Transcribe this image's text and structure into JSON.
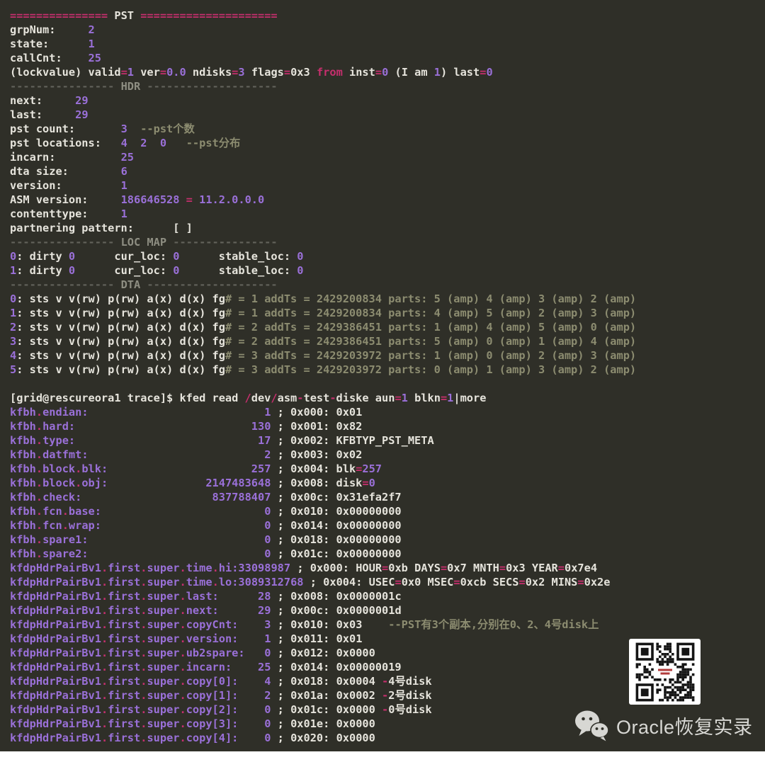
{
  "colors": {
    "bg": "#2f2f28",
    "w": "#e6e4dc",
    "pk": "#c62f6d",
    "pu": "#9a70d8",
    "nm": "#9a70d8",
    "ol": "#8c8c70",
    "gr": "#62625a",
    "grl": "#8e8e82",
    "qr_dark": "#151515",
    "qr_red": "#b23b3b"
  },
  "icons": {
    "wechat": "wechat-chat-bubbles-icon",
    "qr": "qr-code"
  },
  "footer": {
    "brand": "Oracle恢复实录"
  },
  "terminal": {
    "value_col": 40,
    "lines": [
      {
        "n": "pst-header",
        "seg": [
          [
            "pk",
            "==============="
          ],
          [
            "w",
            " PST "
          ],
          [
            "pk",
            "====================="
          ]
        ]
      },
      {
        "n": "grpnum",
        "seg": [
          [
            "w",
            "grpNum:     "
          ],
          [
            "pu",
            "2"
          ]
        ]
      },
      {
        "n": "state",
        "seg": [
          [
            "w",
            "state:      "
          ],
          [
            "pu",
            "1"
          ]
        ]
      },
      {
        "n": "callcnt",
        "seg": [
          [
            "w",
            "callCnt:    "
          ],
          [
            "pu",
            "25"
          ]
        ]
      },
      {
        "n": "lockvalue",
        "seg": [
          [
            "w",
            "(lockvalue) valid"
          ],
          [
            "pk",
            "="
          ],
          [
            "pu",
            "1"
          ],
          [
            "w",
            " ver"
          ],
          [
            "pk",
            "="
          ],
          [
            "pu",
            "0.0"
          ],
          [
            "w",
            " ndisks"
          ],
          [
            "pk",
            "="
          ],
          [
            "pu",
            "3"
          ],
          [
            "w",
            " flags"
          ],
          [
            "pk",
            "="
          ],
          [
            "w",
            "0x3 "
          ],
          [
            "pk",
            "from"
          ],
          [
            "w",
            " inst"
          ],
          [
            "pk",
            "="
          ],
          [
            "pu",
            "0"
          ],
          [
            "w",
            " (I am "
          ],
          [
            "pu",
            "1"
          ],
          [
            "w",
            ") last"
          ],
          [
            "pk",
            "="
          ],
          [
            "pu",
            "0"
          ]
        ]
      },
      {
        "n": "hdr-divider",
        "seg": [
          [
            "gr",
            "----------------"
          ],
          [
            "grl",
            " HDR "
          ],
          [
            "gr",
            "--------------------"
          ]
        ]
      },
      {
        "n": "next",
        "seg": [
          [
            "w",
            "next:     "
          ],
          [
            "pu",
            "29"
          ]
        ]
      },
      {
        "n": "last",
        "seg": [
          [
            "w",
            "last:     "
          ],
          [
            "pu",
            "29"
          ]
        ]
      },
      {
        "n": "pst-count",
        "seg": [
          [
            "w",
            "pst count:       "
          ],
          [
            "pu",
            "3"
          ],
          [
            "ol",
            "  --pst个数"
          ]
        ]
      },
      {
        "n": "pst-locations",
        "seg": [
          [
            "w",
            "pst locations:   "
          ],
          [
            "pu",
            "4"
          ],
          [
            "w",
            "  "
          ],
          [
            "pu",
            "2"
          ],
          [
            "w",
            "  "
          ],
          [
            "pu",
            "0"
          ],
          [
            "ol",
            "   --pst分布"
          ]
        ]
      },
      {
        "n": "incarn",
        "seg": [
          [
            "w",
            "incarn:          "
          ],
          [
            "pu",
            "25"
          ]
        ]
      },
      {
        "n": "dta-size",
        "seg": [
          [
            "w",
            "dta size:        "
          ],
          [
            "pu",
            "6"
          ]
        ]
      },
      {
        "n": "version",
        "seg": [
          [
            "w",
            "version:         "
          ],
          [
            "pu",
            "1"
          ]
        ]
      },
      {
        "n": "asm-version",
        "seg": [
          [
            "w",
            "ASM version:     "
          ],
          [
            "pu",
            "186646528"
          ],
          [
            "w",
            " "
          ],
          [
            "pk",
            "="
          ],
          [
            "w",
            " "
          ],
          [
            "pu",
            "11.2.0.0.0"
          ]
        ]
      },
      {
        "n": "contenttype",
        "seg": [
          [
            "w",
            "contenttype:     "
          ],
          [
            "pu",
            "1"
          ]
        ]
      },
      {
        "n": "partnering-pattern",
        "seg": [
          [
            "w",
            "partnering pattern:      [ ]"
          ]
        ]
      },
      {
        "n": "locmap-divider",
        "seg": [
          [
            "gr",
            "----------------"
          ],
          [
            "grl",
            " LOC MAP "
          ],
          [
            "gr",
            "----------------"
          ]
        ]
      },
      {
        "n": "locmap-0",
        "seg": [
          [
            "pu",
            "0"
          ],
          [
            "w",
            ": dirty "
          ],
          [
            "pu",
            "0"
          ],
          [
            "w",
            "      cur_loc: "
          ],
          [
            "pu",
            "0"
          ],
          [
            "w",
            "      stable_loc: "
          ],
          [
            "pu",
            "0"
          ]
        ]
      },
      {
        "n": "locmap-1",
        "seg": [
          [
            "pu",
            "1"
          ],
          [
            "w",
            ": dirty "
          ],
          [
            "pu",
            "0"
          ],
          [
            "w",
            "      cur_loc: "
          ],
          [
            "pu",
            "0"
          ],
          [
            "w",
            "      stable_loc: "
          ],
          [
            "pu",
            "0"
          ]
        ]
      },
      {
        "n": "dta-divider",
        "seg": [
          [
            "gr",
            "----------------"
          ],
          [
            "grl",
            " DTA "
          ],
          [
            "gr",
            "--------------------"
          ]
        ]
      },
      {
        "n": "dta-0",
        "seg": [
          [
            "pu",
            "0"
          ],
          [
            "w",
            ": sts v v(rw) p(rw) a(x) d(x) fg"
          ],
          [
            "ol",
            "# = 1 addTs = 2429200834 parts: 5 (amp) 4 (amp) 3 (amp) 2 (amp)"
          ]
        ]
      },
      {
        "n": "dta-1",
        "seg": [
          [
            "pu",
            "1"
          ],
          [
            "w",
            ": sts v v(rw) p(rw) a(x) d(x) fg"
          ],
          [
            "ol",
            "# = 1 addTs = 2429200834 parts: 4 (amp) 5 (amp) 2 (amp) 3 (amp)"
          ]
        ]
      },
      {
        "n": "dta-2",
        "seg": [
          [
            "pu",
            "2"
          ],
          [
            "w",
            ": sts v v(rw) p(rw) a(x) d(x) fg"
          ],
          [
            "ol",
            "# = 2 addTs = 2429386451 parts: 1 (amp) 4 (amp) 5 (amp) 0 (amp)"
          ]
        ]
      },
      {
        "n": "dta-3",
        "seg": [
          [
            "pu",
            "3"
          ],
          [
            "w",
            ": sts v v(rw) p(rw) a(x) d(x) fg"
          ],
          [
            "ol",
            "# = 2 addTs = 2429386451 parts: 5 (amp) 0 (amp) 1 (amp) 4 (amp)"
          ]
        ]
      },
      {
        "n": "dta-4",
        "seg": [
          [
            "pu",
            "4"
          ],
          [
            "w",
            ": sts v v(rw) p(rw) a(x) d(x) fg"
          ],
          [
            "ol",
            "# = 3 addTs = 2429203972 parts: 1 (amp) 0 (amp) 2 (amp) 3 (amp)"
          ]
        ]
      },
      {
        "n": "dta-5",
        "seg": [
          [
            "pu",
            "5"
          ],
          [
            "w",
            ": sts v v(rw) p(rw) a(x) d(x) fg"
          ],
          [
            "ol",
            "# = 3 addTs = 2429203972 parts: 0 (amp) 1 (amp) 3 (amp) 2 (amp)"
          ]
        ]
      },
      {
        "n": "blank",
        "seg": []
      },
      {
        "n": "command-prompt",
        "seg": [
          [
            "w",
            "[grid@rescureora1 trace]$ kfed read "
          ],
          [
            "pk",
            "/"
          ],
          [
            "w",
            "dev"
          ],
          [
            "pk",
            "/"
          ],
          [
            "w",
            "asm"
          ],
          [
            "pk",
            "-"
          ],
          [
            "w",
            "test"
          ],
          [
            "pk",
            "-"
          ],
          [
            "w",
            "diske aun"
          ],
          [
            "pk",
            "="
          ],
          [
            "pu",
            "1"
          ],
          [
            "w",
            " blkn"
          ],
          [
            "pk",
            "="
          ],
          [
            "pu",
            "1"
          ],
          [
            "w",
            "|more"
          ]
        ]
      },
      {
        "n": "kfbh-endian",
        "row": {
          "name": "kfbh.endian:",
          "value": "1",
          "suffix": [
            [
              "w",
              " ; 0x000: 0x01"
            ]
          ]
        }
      },
      {
        "n": "kfbh-hard",
        "row": {
          "name": "kfbh.hard:",
          "value": "130",
          "suffix": [
            [
              "w",
              " ; 0x001: 0x82"
            ]
          ]
        }
      },
      {
        "n": "kfbh-type",
        "row": {
          "name": "kfbh.type:",
          "value": "17",
          "suffix": [
            [
              "w",
              " ; 0x002: KFBTYP_PST_META"
            ]
          ]
        }
      },
      {
        "n": "kfbh-datfmt",
        "row": {
          "name": "kfbh.datfmt:",
          "value": "2",
          "suffix": [
            [
              "w",
              " ; 0x003: 0x02"
            ]
          ]
        }
      },
      {
        "n": "kfbh-block-blk",
        "row": {
          "name": "kfbh.block.blk:",
          "value": "257",
          "suffix": [
            [
              "w",
              " ; 0x004: blk"
            ],
            [
              "pk",
              "="
            ],
            [
              "pu",
              "257"
            ]
          ]
        }
      },
      {
        "n": "kfbh-block-obj",
        "row": {
          "name": "kfbh.block.obj:",
          "value": "2147483648",
          "suffix": [
            [
              "w",
              " ; 0x008: disk"
            ],
            [
              "pk",
              "="
            ],
            [
              "pu",
              "0"
            ]
          ]
        }
      },
      {
        "n": "kfbh-check",
        "row": {
          "name": "kfbh.check:",
          "value": "837788407",
          "suffix": [
            [
              "w",
              " ; 0x00c: 0x31efa2f7"
            ]
          ]
        }
      },
      {
        "n": "kfbh-fcn-base",
        "row": {
          "name": "kfbh.fcn.base:",
          "value": "0",
          "suffix": [
            [
              "w",
              " ; 0x010: 0x00000000"
            ]
          ]
        }
      },
      {
        "n": "kfbh-fcn-wrap",
        "row": {
          "name": "kfbh.fcn.wrap:",
          "value": "0",
          "suffix": [
            [
              "w",
              " ; 0x014: 0x00000000"
            ]
          ]
        }
      },
      {
        "n": "kfbh-spare1",
        "row": {
          "name": "kfbh.spare1:",
          "value": "0",
          "suffix": [
            [
              "w",
              " ; 0x018: 0x00000000"
            ]
          ]
        }
      },
      {
        "n": "kfbh-spare2",
        "row": {
          "name": "kfbh.spare2:",
          "value": "0",
          "suffix": [
            [
              "w",
              " ; 0x01c: 0x00000000"
            ]
          ]
        }
      },
      {
        "n": "kfdp-time-hi",
        "row": {
          "name": "kfdpHdrPairBv1.first.super.time.hi:",
          "value": "33098987",
          "suffix": [
            [
              "w",
              " ; 0x000: HOUR"
            ],
            [
              "pk",
              "="
            ],
            [
              "w",
              "0xb DAYS"
            ],
            [
              "pk",
              "="
            ],
            [
              "w",
              "0x7 MNTH"
            ],
            [
              "pk",
              "="
            ],
            [
              "w",
              "0x3 YEAR"
            ],
            [
              "pk",
              "="
            ],
            [
              "w",
              "0x7e4"
            ]
          ]
        }
      },
      {
        "n": "kfdp-time-lo",
        "row": {
          "name": "kfdpHdrPairBv1.first.super.time.lo:",
          "value": "3089312768",
          "suffix": [
            [
              "w",
              " ; 0x004: USEC"
            ],
            [
              "pk",
              "="
            ],
            [
              "w",
              "0x0 MSEC"
            ],
            [
              "pk",
              "="
            ],
            [
              "w",
              "0xcb SECS"
            ],
            [
              "pk",
              "="
            ],
            [
              "w",
              "0x2 MINS"
            ],
            [
              "pk",
              "="
            ],
            [
              "w",
              "0x2e"
            ]
          ]
        }
      },
      {
        "n": "kfdp-last",
        "row": {
          "name": "kfdpHdrPairBv1.first.super.last:",
          "value": "28",
          "suffix": [
            [
              "w",
              " ; 0x008: 0x0000001c"
            ]
          ]
        }
      },
      {
        "n": "kfdp-next",
        "row": {
          "name": "kfdpHdrPairBv1.first.super.next:",
          "value": "29",
          "suffix": [
            [
              "w",
              " ; 0x00c: 0x0000001d"
            ]
          ]
        }
      },
      {
        "n": "kfdp-copycnt",
        "row": {
          "name": "kfdpHdrPairBv1.first.super.copyCnt:",
          "value": "3",
          "suffix": [
            [
              "w",
              " ; 0x010: 0x03"
            ],
            [
              "ol",
              "    --PST有3个副本,分别在0、2、4号disk上"
            ]
          ]
        }
      },
      {
        "n": "kfdp-version",
        "row": {
          "name": "kfdpHdrPairBv1.first.super.version:",
          "value": "1",
          "suffix": [
            [
              "w",
              " ; 0x011: 0x01"
            ]
          ]
        }
      },
      {
        "n": "kfdp-ub2spare",
        "row": {
          "name": "kfdpHdrPairBv1.first.super.ub2spare:",
          "value": "0",
          "suffix": [
            [
              "w",
              " ; 0x012: 0x0000"
            ]
          ]
        }
      },
      {
        "n": "kfdp-incarn",
        "row": {
          "name": "kfdpHdrPairBv1.first.super.incarn:",
          "value": "25",
          "suffix": [
            [
              "w",
              " ; 0x014: 0x00000019"
            ]
          ]
        }
      },
      {
        "n": "kfdp-copy0",
        "row": {
          "name": "kfdpHdrPairBv1.first.super.copy[0]:",
          "value": "4",
          "suffix": [
            [
              "w",
              " ; 0x018: 0x0004 "
            ],
            [
              "pk",
              "-"
            ],
            [
              "w",
              "4号disk"
            ]
          ]
        }
      },
      {
        "n": "kfdp-copy1",
        "row": {
          "name": "kfdpHdrPairBv1.first.super.copy[1]:",
          "value": "2",
          "suffix": [
            [
              "w",
              " ; 0x01a: 0x0002 "
            ],
            [
              "pk",
              "-"
            ],
            [
              "w",
              "2号disk"
            ]
          ]
        }
      },
      {
        "n": "kfdp-copy2",
        "row": {
          "name": "kfdpHdrPairBv1.first.super.copy[2]:",
          "value": "0",
          "suffix": [
            [
              "w",
              " ; 0x01c: 0x0000 "
            ],
            [
              "pk",
              "-"
            ],
            [
              "w",
              "0号disk"
            ]
          ]
        }
      },
      {
        "n": "kfdp-copy3",
        "row": {
          "name": "kfdpHdrPairBv1.first.super.copy[3]:",
          "value": "0",
          "suffix": [
            [
              "w",
              " ; 0x01e: 0x0000"
            ]
          ]
        }
      },
      {
        "n": "kfdp-copy4",
        "row": {
          "name": "kfdpHdrPairBv1.first.super.copy[4]:",
          "value": "0",
          "suffix": [
            [
              "w",
              " ; 0x020: 0x0000"
            ]
          ]
        }
      }
    ]
  }
}
